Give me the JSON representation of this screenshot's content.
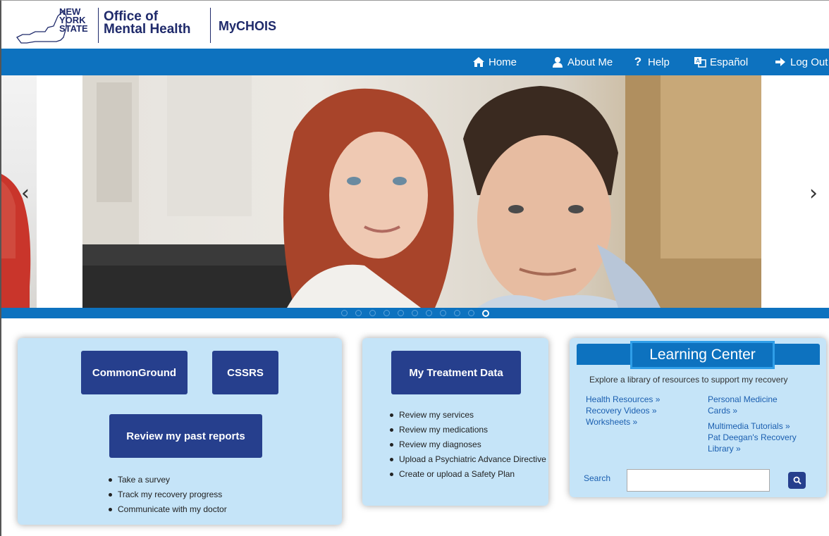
{
  "header": {
    "state_logo_lines": [
      "NEW",
      "YORK",
      "STATE"
    ],
    "agency_name_line1": "Office of",
    "agency_name_line2": "Mental Health",
    "app_name": "MyCHOIS"
  },
  "nav": {
    "items": [
      {
        "label": "Home",
        "icon": "home-icon"
      },
      {
        "label": "About Me",
        "icon": "user-icon"
      },
      {
        "label": "Help",
        "icon": "question-icon"
      },
      {
        "label": "Español",
        "icon": "translate-icon"
      },
      {
        "label": "Log Out",
        "icon": "logout-icon"
      }
    ],
    "color": "#0d72bf"
  },
  "carousel": {
    "prev_symbol": "‹",
    "next_symbol": "›",
    "slide_count": 11,
    "active_slide": 11
  },
  "card_left": {
    "commonground_label": "CommonGround",
    "cssrs_label": "CSSRS",
    "past_reports_label": "Review my past reports",
    "bullets": [
      "Take a survey",
      "Track my recovery progress",
      "Communicate with my doctor"
    ]
  },
  "card_middle": {
    "treatment_label": "My Treatment Data",
    "bullets": [
      "Review my services",
      "Review my medications",
      "Review my diagnoses",
      "Upload a Psychiatric Advance Directive",
      "Create or upload a Safety Plan"
    ]
  },
  "learning_center": {
    "title": "Learning Center",
    "description": "Explore a library of resources to support my recovery",
    "links_left": [
      "Health Resources »",
      "Recovery Videos »",
      "Worksheets »"
    ],
    "links_right": {
      "personal_medicine_line1": "Personal Medicine",
      "personal_medicine_line2": "Cards »",
      "multimedia": "Multimedia Tutorials »",
      "pat_deegan_line1": "Pat Deegan's Recovery",
      "pat_deegan_line2": "Library »"
    },
    "search_label": "Search",
    "search_value": ""
  },
  "colors": {
    "brand_blue": "#0d72bf",
    "button_navy": "#263f8d",
    "card_bg": "#c5e4f8",
    "highlight": "#2f9ee8"
  }
}
